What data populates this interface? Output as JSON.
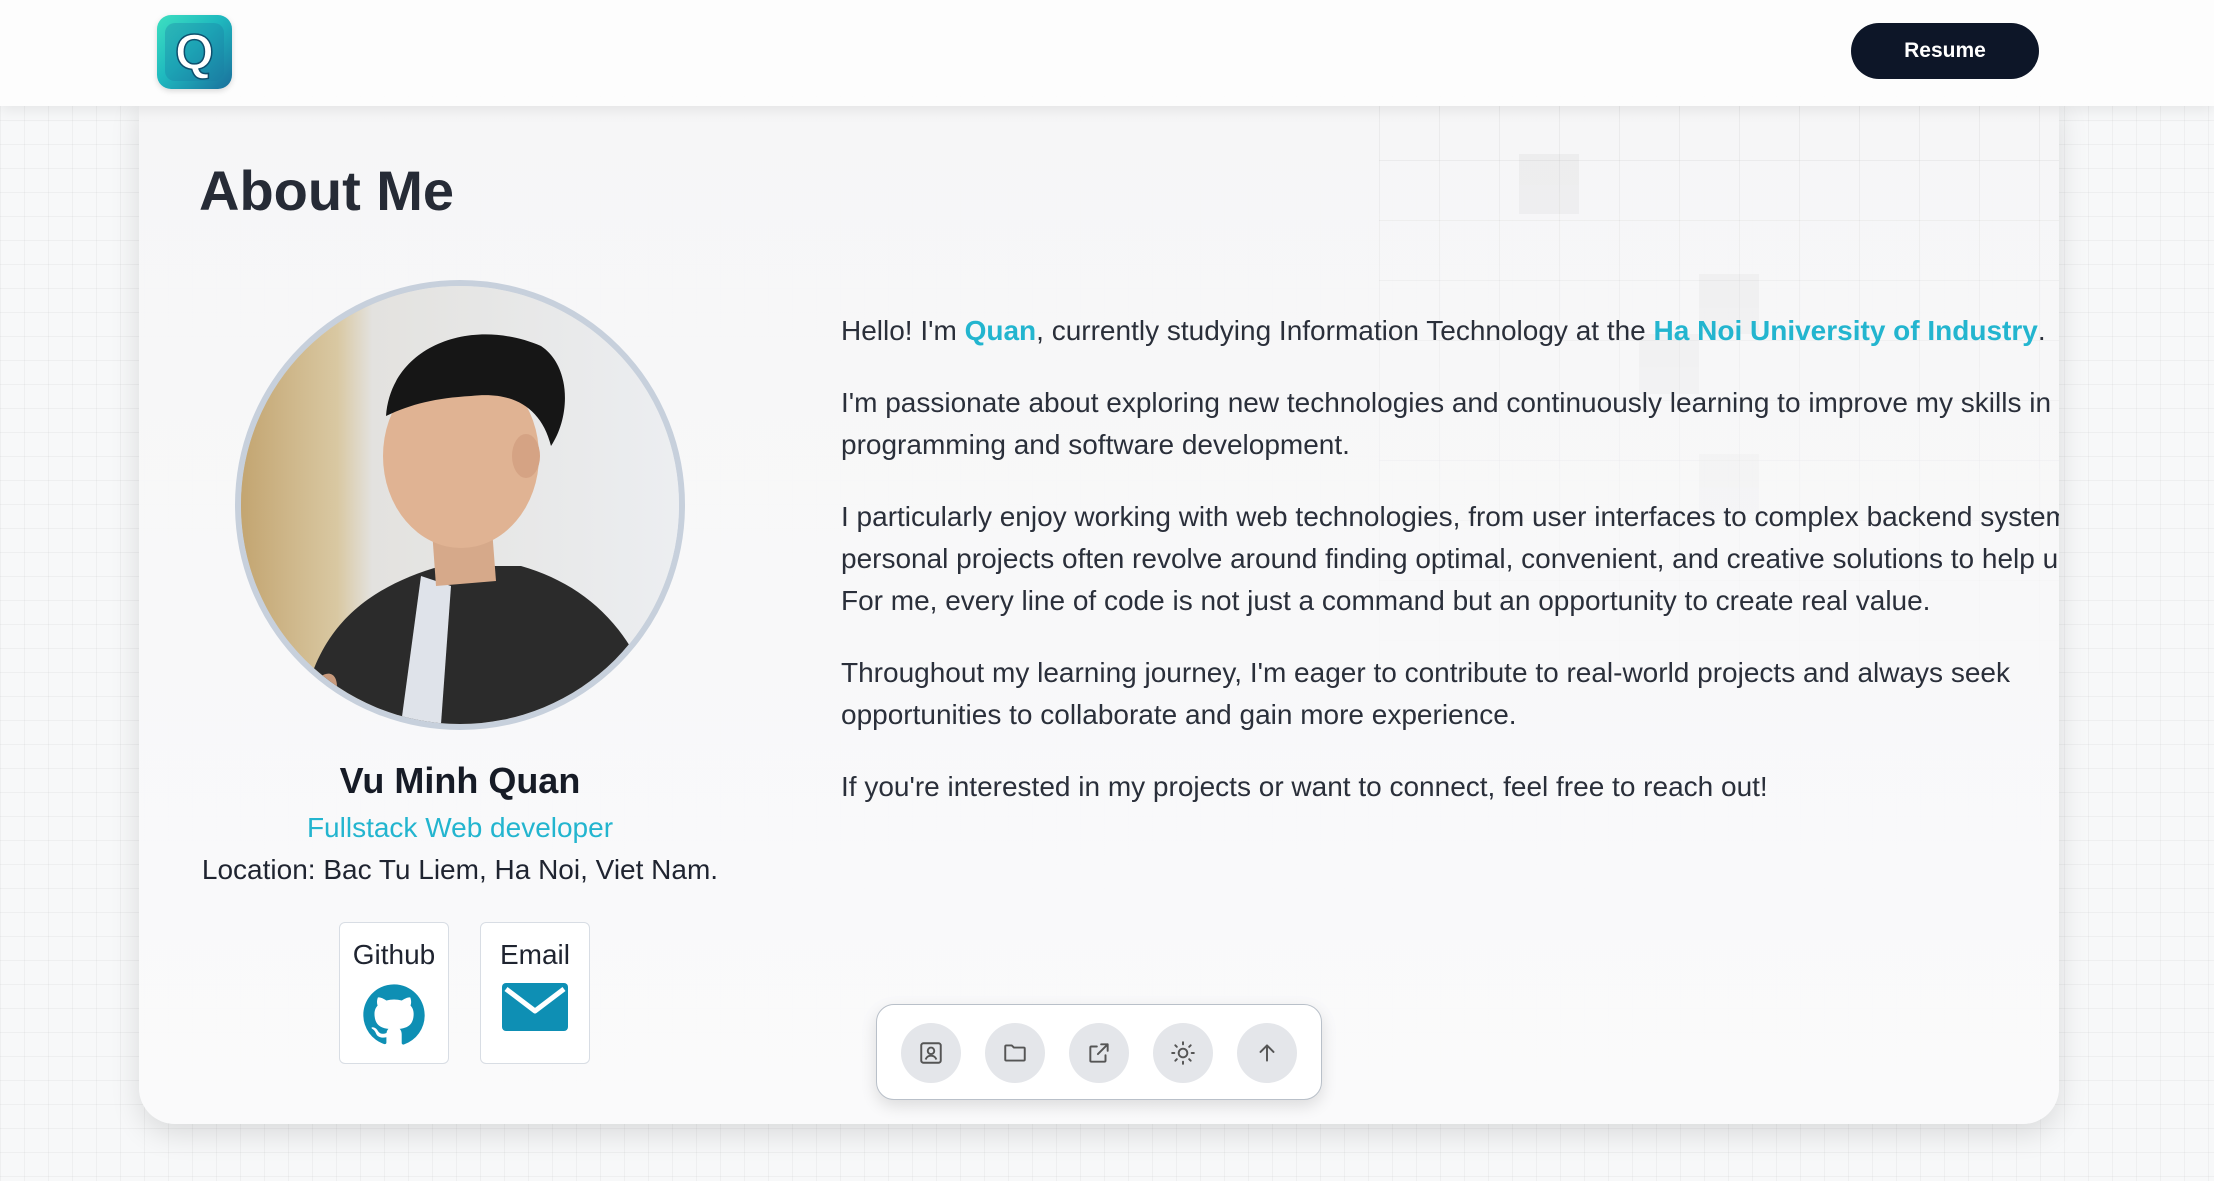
{
  "header": {
    "logo_letter": "Q",
    "resume_label": "Resume"
  },
  "about": {
    "title": "About Me",
    "paragraphs": {
      "p1": {
        "pre": "Hello! I'm ",
        "name": "Quan",
        "mid": ", currently studying Information Technology at the ",
        "university": "Ha Noi University of Industry",
        "post": "."
      },
      "p2": "I'm passionate about exploring new technologies and continuously learning to improve my skills in programming and software development.",
      "p3": "I particularly enjoy working with web technologies, from user interfaces to complex backend systems. My personal projects often revolve around finding optimal, convenient, and creative solutions to help users. For me, every line of code is not just a command but an opportunity to create real value.",
      "p4": "Throughout my learning journey, I'm eager to contribute to real-world projects and always seek opportunities to collaborate and gain more experience.",
      "p5": "If you're interested in my projects or want to connect, feel free to reach out!"
    }
  },
  "profile": {
    "name": "Vu Minh Quan",
    "role": "Fullstack Web developer",
    "location": "Location: Bac Tu Liem, Ha Noi, Viet Nam.",
    "links": [
      {
        "label": "Github",
        "icon": "github-icon"
      },
      {
        "label": "Email",
        "icon": "mail-icon"
      }
    ]
  },
  "dock": {
    "items": [
      "contact-card-icon",
      "folder-icon",
      "external-link-icon",
      "sun-icon",
      "arrow-up-icon"
    ]
  },
  "colors": {
    "accent": "#23b5cf",
    "dark_button": "#0d1628",
    "icon_teal": "#0e8fb4"
  }
}
